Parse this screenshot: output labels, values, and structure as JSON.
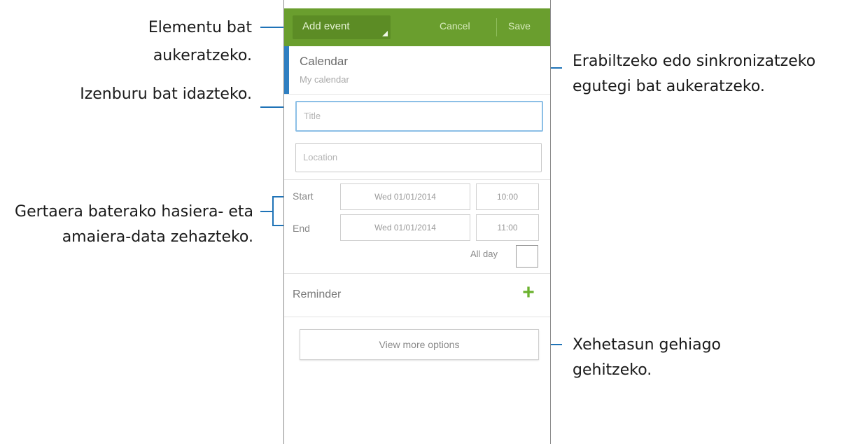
{
  "app": {
    "actionbar": {
      "mode_label": "Add event",
      "cancel_label": "Cancel",
      "save_label": "Save",
      "color": "#6a9e2e"
    },
    "calendar": {
      "title": "Calendar",
      "subtitle": "My calendar",
      "accent": "#2f7fc1"
    },
    "title_field": {
      "placeholder": "Title"
    },
    "location_field": {
      "placeholder": "Location"
    },
    "start": {
      "label": "Start",
      "date": "Wed 01/01/2014",
      "time": "10:00"
    },
    "end": {
      "label": "End",
      "date": "Wed 01/01/2014",
      "time": "11:00"
    },
    "all_day": {
      "label": "All day",
      "checked": false
    },
    "reminder": {
      "label": "Reminder",
      "icon": "plus-icon"
    },
    "more_options_label": "View more options"
  },
  "callouts": {
    "select_item": {
      "line1": "Elementu bat",
      "line2": "aukeratzeko."
    },
    "enter_title": "Izenburu bat idazteko.",
    "set_dates": {
      "line1": "Gertaera baterako hasiera- eta",
      "line2": "amaiera-data zehazteko."
    },
    "select_calendar": {
      "line1": "Erabiltzeko edo sinkronizatzeko",
      "line2": "egutegi bat aukeratzeko."
    },
    "add_details": {
      "line1": "Xehetasun gehiago",
      "line2": "gehitzeko."
    }
  }
}
